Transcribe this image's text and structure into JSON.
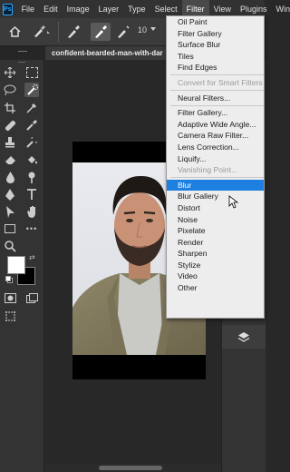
{
  "app": {
    "logo_text": "Ps"
  },
  "menubar": {
    "items": [
      "File",
      "Edit",
      "Image",
      "Layer",
      "Type",
      "Select",
      "Filter",
      "View",
      "Plugins",
      "Win"
    ],
    "active_index": 6
  },
  "options_bar": {
    "brush_size": "10",
    "home_icon": "home-icon",
    "brush_preset_icon": "brush-preset-icon"
  },
  "document": {
    "tab_title": "confident-bearded-man-with-dar"
  },
  "filter_menu": {
    "items": [
      {
        "label": "Oil Paint",
        "state": "normal"
      },
      {
        "label": "Filter Gallery",
        "state": "normal"
      },
      {
        "label": "Surface Blur",
        "state": "normal"
      },
      {
        "label": "Tiles",
        "state": "normal"
      },
      {
        "label": "Find Edges",
        "state": "normal"
      },
      {
        "sep": true
      },
      {
        "label": "Convert for Smart Filters",
        "state": "disabled"
      },
      {
        "sep": true
      },
      {
        "label": "Neural Filters...",
        "state": "normal"
      },
      {
        "sep": true
      },
      {
        "label": "Filter Gallery...",
        "state": "normal"
      },
      {
        "label": "Adaptive Wide Angle...",
        "state": "normal"
      },
      {
        "label": "Camera Raw Filter...",
        "state": "normal"
      },
      {
        "label": "Lens Correction...",
        "state": "normal"
      },
      {
        "label": "Liquify...",
        "state": "normal"
      },
      {
        "label": "Vanishing Point...",
        "state": "disabled"
      },
      {
        "sep": true
      },
      {
        "label": "Blur",
        "state": "highlighted"
      },
      {
        "label": "Blur Gallery",
        "state": "normal"
      },
      {
        "label": "Distort",
        "state": "normal"
      },
      {
        "label": "Noise",
        "state": "normal"
      },
      {
        "label": "Pixelate",
        "state": "normal"
      },
      {
        "label": "Render",
        "state": "normal"
      },
      {
        "label": "Sharpen",
        "state": "normal"
      },
      {
        "label": "Stylize",
        "state": "normal"
      },
      {
        "label": "Video",
        "state": "normal"
      },
      {
        "label": "Other",
        "state": "normal"
      }
    ]
  },
  "colors": {
    "foreground": "#ffffff",
    "background": "#000000",
    "highlight": "#1d80e0",
    "logo_accent": "#31a8ff"
  }
}
